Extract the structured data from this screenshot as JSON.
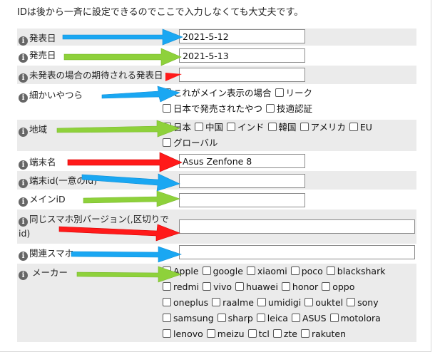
{
  "notice": "IDは後から一斉に設定できるのでここで入力しなくても大丈夫です。",
  "fields": {
    "release_date": {
      "label": "発表日",
      "value": "2021-5-12"
    },
    "sale_date": {
      "label": "発売日",
      "value": "2021-5-13"
    },
    "expected_date": {
      "label": "未発表の場合の期待される発表日",
      "value": ""
    },
    "details": {
      "label": "細かいやつら"
    },
    "region": {
      "label": "地域"
    },
    "device_name": {
      "label": "端末名",
      "value": "Asus Zenfone 8"
    },
    "device_id": {
      "label": "端末id(一意のid)",
      "value": ""
    },
    "main_id": {
      "label": "メインiD",
      "value": ""
    },
    "variant_ids": {
      "label": "同じスマホ別バージョン(,区切りでid)",
      "value": ""
    },
    "related": {
      "label": "関連スマホ",
      "value": ""
    },
    "maker": {
      "label": "メーカー"
    }
  },
  "details_options": [
    "これがメイン表示の場合",
    "リーク",
    "日本で発売されたやつ",
    "技適認証"
  ],
  "region_options": [
    "日本",
    "中国",
    "インド",
    "韓国",
    "アメリカ",
    "EU",
    "グローバル"
  ],
  "maker_options": [
    "Apple",
    "google",
    "xiaomi",
    "poco",
    "blackshark",
    "redmi",
    "vivo",
    "huawei",
    "honor",
    "oppo",
    "oneplus",
    "raalme",
    "umidigi",
    "ouktel",
    "sony",
    "samsung",
    "sharp",
    "leica",
    "ASUS",
    "motolora",
    "lenovo",
    "meizu",
    "tcl",
    "zte",
    "rakuten"
  ],
  "icons": {
    "info": "info-icon",
    "checkbox": "checkbox-icon"
  },
  "colors": {
    "arrow_blue": "#1aa7f2",
    "arrow_green": "#8ed13b",
    "arrow_red": "#ff1a1a",
    "row_shade": "#ebebeb"
  }
}
